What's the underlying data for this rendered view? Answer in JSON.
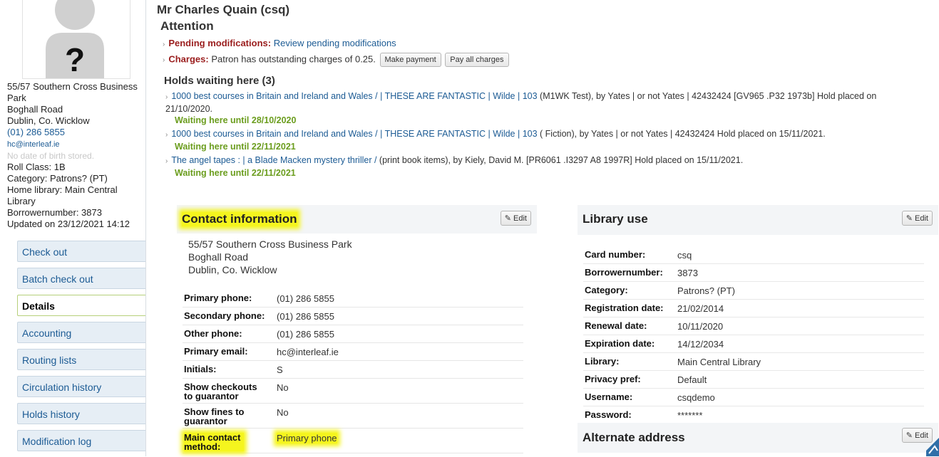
{
  "patron": {
    "name": "Mr Charles Quain (csq)",
    "address1": "55/57 Southern Cross Business Park",
    "address2": "Boghall Road",
    "address3": "Dublin, Co. Wicklow",
    "phone": "(01) 286 5855",
    "email": "hc@interleaf.ie",
    "dob": "No date of birth stored.",
    "roll_class": "Roll Class: 1B",
    "category": "Category: Patrons? (PT)",
    "home_library": "Home library: Main Central Library",
    "borrowernumber": "Borrowernumber: 3873",
    "updated": "Updated on 23/12/2021 14:12"
  },
  "menu": [
    "Check out",
    "Batch check out",
    "Details",
    "Accounting",
    "Routing lists",
    "Circulation history",
    "Holds history",
    "Modification log"
  ],
  "attention": {
    "title": "Attention",
    "pending_label": "Pending modifications:",
    "pending_link": "Review pending modifications",
    "charges_label": "Charges:",
    "charges_text": "Patron has outstanding charges of 0.25.",
    "make_payment": "Make payment",
    "pay_all": "Pay all charges"
  },
  "holds": {
    "title": "Holds waiting here (3)",
    "items": [
      {
        "link": "1000 best courses in Britain and Ireland and Wales / | THESE ARE FANTASTIC | Wilde | 103",
        "text": " (M1WK Test), by Yates | or not Yates | 42432424 [GV965 .P32 1973b] Hold placed on 21/10/2020.",
        "wait": "Waiting here until 28/10/2020"
      },
      {
        "link": "1000 best courses in Britain and Ireland and Wales / | THESE ARE FANTASTIC | Wilde | 103",
        "text": " ( Fiction), by Yates | or not Yates | 42432424 Hold placed on 15/11/2021.",
        "wait": "Waiting here until 22/11/2021"
      },
      {
        "link": "The angel tapes : | a Blade Macken mystery thriller /",
        "text": " (print book items), by Kiely, David M. [PR6061 .I3297 A8 1997R] Hold placed on 15/11/2021.",
        "wait": "Waiting here until 22/11/2021"
      }
    ]
  },
  "contact": {
    "title": "Contact information",
    "edit": "Edit",
    "address1": "55/57 Southern Cross Business Park",
    "address2": "Boghall Road",
    "address3": "Dublin, Co. Wicklow",
    "rows": [
      {
        "label": "Primary phone:",
        "value": "(01) 286 5855"
      },
      {
        "label": "Secondary phone:",
        "value": "(01) 286 5855"
      },
      {
        "label": "Other phone:",
        "value": "(01) 286 5855"
      },
      {
        "label": "Primary email:",
        "value": "hc@interleaf.ie"
      },
      {
        "label": "Initials:",
        "value": "S"
      },
      {
        "label": "Show checkouts to guarantor",
        "value": "No"
      },
      {
        "label": "Show fines to guarantor",
        "value": "No"
      },
      {
        "label": "Main contact method:",
        "value": "Primary phone"
      }
    ]
  },
  "library_use": {
    "title": "Library use",
    "edit": "Edit",
    "rows": [
      {
        "label": "Card number:",
        "value": "csq"
      },
      {
        "label": "Borrowernumber:",
        "value": "3873"
      },
      {
        "label": "Category:",
        "value": "Patrons? (PT)"
      },
      {
        "label": "Registration date:",
        "value": "21/02/2014"
      },
      {
        "label": "Renewal date:",
        "value": "10/11/2020"
      },
      {
        "label": "Expiration date:",
        "value": "14/12/2034"
      },
      {
        "label": "Library:",
        "value": "Main Central Library"
      },
      {
        "label": "Privacy pref:",
        "value": "Default"
      },
      {
        "label": "Username:",
        "value": "csqdemo"
      },
      {
        "label": "Password:",
        "value": "*******"
      }
    ]
  },
  "alternate": {
    "title": "Alternate address",
    "edit": "Edit"
  },
  "colors": {
    "link": "#1c5b94",
    "alert": "#9a1d1d",
    "waiting": "#6b9d1e",
    "highlight": "#f5f51e"
  },
  "icons": [
    "pencil-icon",
    "avatar-placeholder-icon",
    "chevron-right-icon"
  ]
}
